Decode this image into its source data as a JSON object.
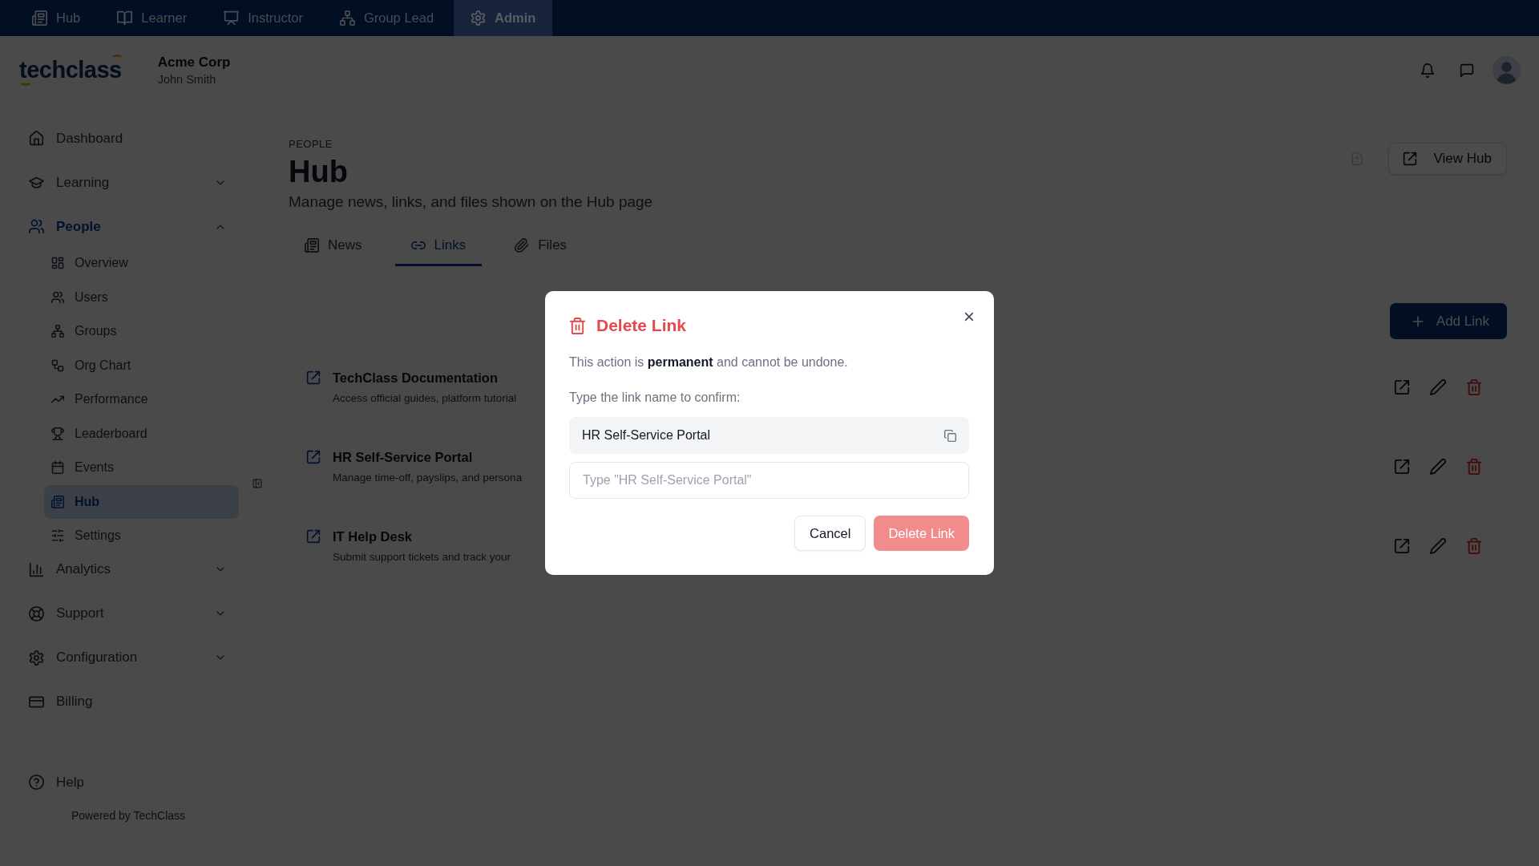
{
  "top_nav": [
    {
      "label": "Hub",
      "selected": false
    },
    {
      "label": "Learner",
      "selected": false
    },
    {
      "label": "Instructor",
      "selected": false
    },
    {
      "label": "Group Lead",
      "selected": false
    },
    {
      "label": "Admin",
      "selected": true
    }
  ],
  "header": {
    "logo": "techclass",
    "organization": "Acme Corp",
    "user": "John Smith"
  },
  "sidebar": {
    "items": [
      {
        "label": "Dashboard",
        "kind": "link",
        "selected": false
      },
      {
        "label": "Learning",
        "kind": "group",
        "selected": false,
        "expanded": false
      },
      {
        "label": "People",
        "kind": "group",
        "selected": true,
        "expanded": true,
        "children": [
          {
            "label": "Overview",
            "selected": false
          },
          {
            "label": "Users",
            "selected": false
          },
          {
            "label": "Groups",
            "selected": false
          },
          {
            "label": "Org Chart",
            "selected": false
          },
          {
            "label": "Performance",
            "selected": false
          },
          {
            "label": "Leaderboard",
            "selected": false
          },
          {
            "label": "Events",
            "selected": false
          },
          {
            "label": "Hub",
            "selected": true
          },
          {
            "label": "Settings",
            "selected": false
          }
        ]
      },
      {
        "label": "Analytics",
        "kind": "group",
        "selected": false,
        "expanded": false
      },
      {
        "label": "Support",
        "kind": "group",
        "selected": false,
        "expanded": false
      },
      {
        "label": "Configuration",
        "kind": "group",
        "selected": false,
        "expanded": false
      },
      {
        "label": "Billing",
        "kind": "link",
        "selected": false
      }
    ],
    "help": "Help",
    "footer": "Powered by TechClass"
  },
  "page": {
    "eyebrow": "PEOPLE",
    "title": "Hub",
    "subtitle": "Manage news, links, and files shown on the Hub page",
    "view_button": "View Hub"
  },
  "tabs": [
    {
      "label": "News",
      "selected": false
    },
    {
      "label": "Links",
      "selected": true
    },
    {
      "label": "Files",
      "selected": false
    }
  ],
  "add_button": "Add Link",
  "links": [
    {
      "title": "TechClass Documentation",
      "description": "Access official guides, platform tutorial"
    },
    {
      "title": "HR Self-Service Portal",
      "description": "Manage time-off, payslips, and persona"
    },
    {
      "title": "IT Help Desk",
      "description": "Submit support tickets and track your"
    }
  ],
  "dialog": {
    "title": "Delete Link",
    "message": "This action is **permanent** and cannot be undone.",
    "prompt": "Type the link name to confirm:",
    "name_value": "HR Self-Service Portal",
    "input": {
      "placeholder": "Type \"HR Self-Service Portal\""
    },
    "buttons": [
      {
        "label": "Cancel",
        "kind": "secondary",
        "disabled": false
      },
      {
        "label": "Delete Link",
        "kind": "danger",
        "disabled": true
      }
    ]
  }
}
